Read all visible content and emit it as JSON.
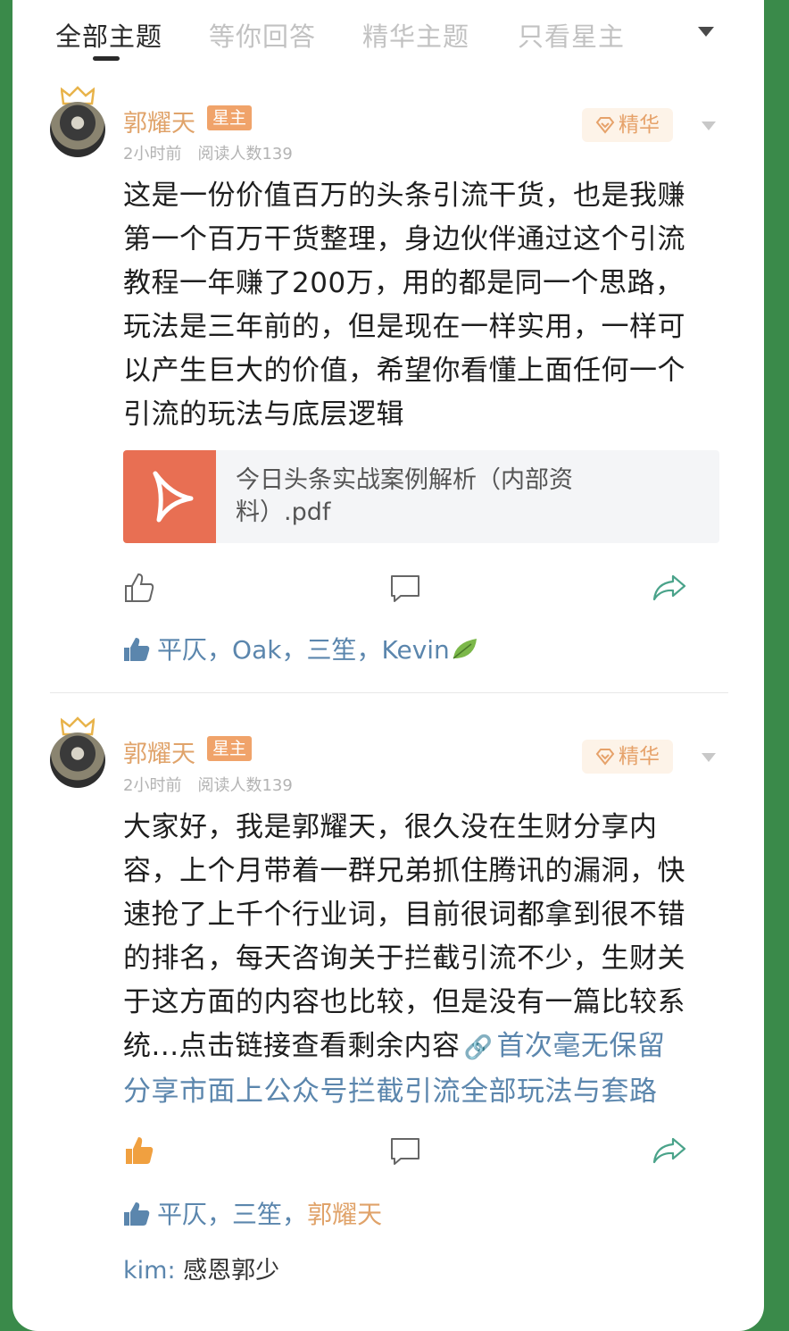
{
  "tabs": [
    {
      "label": "全部主题",
      "active": true
    },
    {
      "label": "等你回答",
      "active": false
    },
    {
      "label": "精华主题",
      "active": false
    },
    {
      "label": "只看星主",
      "active": false
    }
  ],
  "posts": [
    {
      "author": "郭耀天",
      "badge": "星主",
      "time": "2小时前",
      "reads": "阅读人数139",
      "essence_label": "精华",
      "lines": [
        "这是一份价值百万的头条引流干货，也是我赚",
        "第一个百万干货整理，身边伙伴通过这个引流",
        "教程一年赚了200万，用的都是同一个思路，",
        "玩法是三年前的，但是现在一样实用，一样可",
        "以产生巨大的价值，希望你看懂上面任何一个",
        "引流的玩法与底层逻辑"
      ],
      "attachment": "今日头条实战案例解析（内部资料）.pdf",
      "liked": false,
      "likers": [
        {
          "name": "平仄",
          "sep": "，"
        },
        {
          "name": "Oak",
          "sep": "，"
        },
        {
          "name": "三笙",
          "sep": "，"
        },
        {
          "name": "Kevin",
          "sep": ""
        }
      ]
    },
    {
      "author": "郭耀天",
      "badge": "星主",
      "time": "2小时前",
      "reads": "阅读人数139",
      "essence_label": "精华",
      "lines": [
        "大家好，我是郭耀天，很久没在生财分享内",
        "容，上个月带着一群兄弟抓住腾讯的漏洞，快",
        "速抢了上千个行业词，目前很词都拿到很不错",
        "的排名，每天咨询关于拦截引流不少，生财关",
        "于这方面的内容也比较，但是没有一篇比较系"
      ],
      "line6_plain": "统...点击链接查看剩余内容",
      "link_part1": "首次毫无保留",
      "link_part2": "分享市面上公众号拦截引流全部玩法与套路",
      "liked": true,
      "likers": [
        {
          "name": "平仄",
          "sep": "，"
        },
        {
          "name": "三笙",
          "sep": "，"
        },
        {
          "name": "郭耀天",
          "sep": ""
        }
      ],
      "comment": {
        "name": "kim:",
        "text": "感恩郭少"
      }
    }
  ],
  "colors": {
    "accent_orange": "#e0a36a",
    "link_blue": "#5b86ad",
    "share_green": "#4aa38a",
    "pdf_red": "#e86f53",
    "liked_orange": "#f0a040"
  },
  "icons": [
    "crown-icon",
    "essence-icon",
    "chevron-down-icon",
    "pdf-icon",
    "thumb-up-icon",
    "comment-icon",
    "share-icon",
    "link-icon",
    "leaf-icon"
  ]
}
